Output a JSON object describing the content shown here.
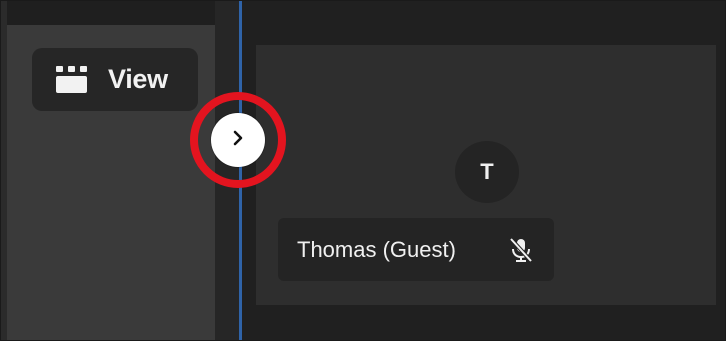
{
  "toolbar": {
    "view_label": "View",
    "view_icon": "grid-layout-icon"
  },
  "sidebar_toggle": {
    "icon": "chevron-right-icon",
    "highlight_color": "#e3141f"
  },
  "participant": {
    "initial": "T",
    "name": "Thomas (Guest)",
    "mic_icon": "mic-muted-icon"
  },
  "colors": {
    "divider_accent": "#2f63a8",
    "background": "#1f1f1f",
    "panel": "#3a3a3a",
    "tile": "#2e2e2e"
  }
}
